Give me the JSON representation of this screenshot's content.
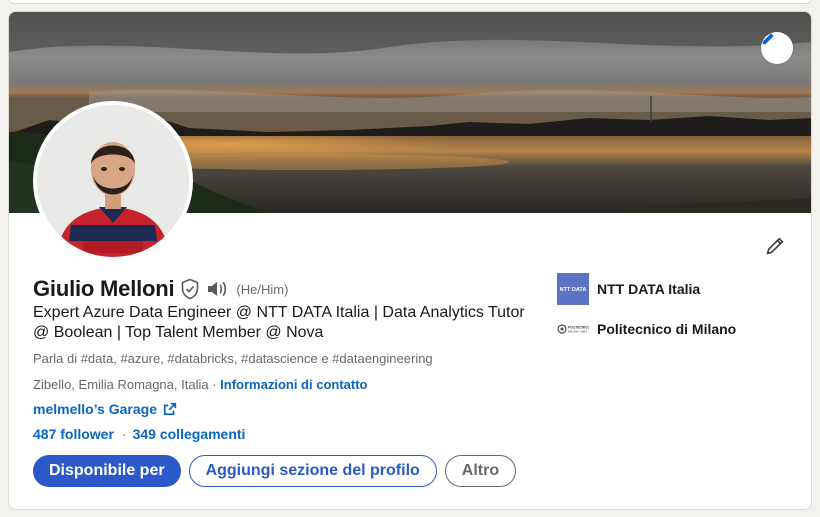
{
  "profile": {
    "name": "Giulio Melloni",
    "pronouns": "(He/Him)",
    "headline": "Expert Azure Data Engineer @ NTT DATA Italia | Data Analytics Tutor @ Boolean | Top Talent Member @ Nova",
    "talks_about": "Parla di #data, #azure, #databricks, #datascience e #dataengineering",
    "location": "Zibello, Emilia Romagna, Italia",
    "location_separator": "·",
    "contact_info_label": "Informazioni di contatto",
    "website_label": "melmello’s Garage",
    "followers": "487 follower",
    "stats_separator": "·",
    "connections": "349 collegamenti"
  },
  "actions": {
    "open_to": "Disponibile per",
    "add_section": "Aggiungi sezione del profilo",
    "more": "Altro"
  },
  "organizations": [
    {
      "name": "NTT DATA Italia",
      "logo_text": "NTT DATA",
      "logo_color": "#5a73c4"
    },
    {
      "name": "Politecnico di Milano",
      "logo_text": "POLITECNICO MILANO 1863"
    }
  ],
  "colors": {
    "accent": "#2c58c9",
    "link": "#0a66c2"
  },
  "icons": {
    "verified": "shield-check-icon",
    "pronunciation": "speaker-icon",
    "external_link": "external-link-icon",
    "edit": "pencil-icon"
  }
}
